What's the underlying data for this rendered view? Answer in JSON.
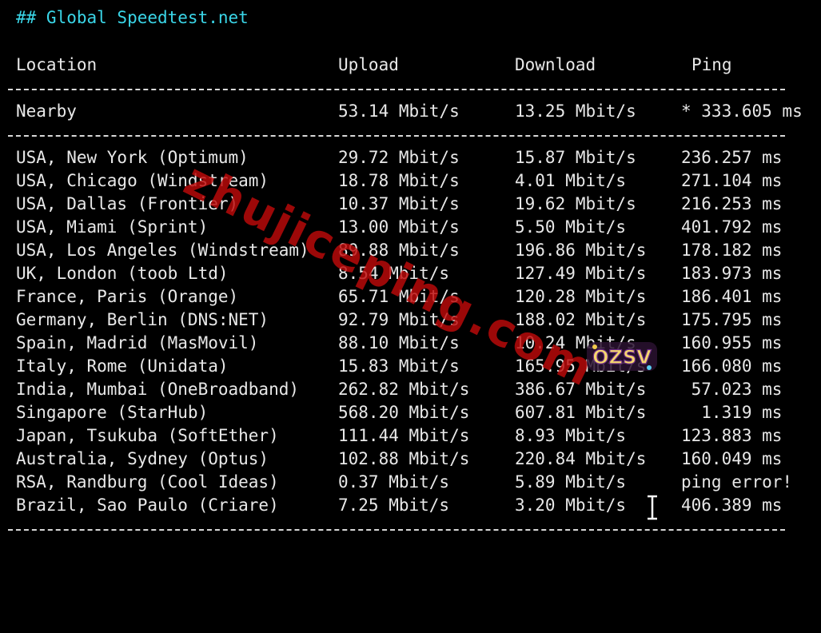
{
  "heading": "## Global Speedtest.net",
  "columns": {
    "location": "Location",
    "upload": "Upload",
    "download": "Download",
    "ping": "Ping"
  },
  "nearby": {
    "location": "Nearby",
    "upload": "53.14 Mbit/s",
    "download": "13.25 Mbit/s",
    "ping": "* 333.605 ms"
  },
  "rows": [
    {
      "location": "USA, New York (Optimum)",
      "upload": "29.72 Mbit/s",
      "download": "15.87 Mbit/s",
      "ping": "236.257 ms"
    },
    {
      "location": "USA, Chicago (Windstream)",
      "upload": "18.78 Mbit/s",
      "download": "4.01 Mbit/s",
      "ping": "271.104 ms"
    },
    {
      "location": "USA, Dallas (Frontier)",
      "upload": "10.37 Mbit/s",
      "download": "19.62 Mbit/s",
      "ping": "216.253 ms"
    },
    {
      "location": "USA, Miami (Sprint)",
      "upload": "13.00 Mbit/s",
      "download": "5.50 Mbit/s",
      "ping": "401.792 ms"
    },
    {
      "location": "USA, Los Angeles (Windstream)",
      "upload": "89.88 Mbit/s",
      "download": "196.86 Mbit/s",
      "ping": "178.182 ms"
    },
    {
      "location": "UK, London (toob Ltd)",
      "upload": "8.54 Mbit/s",
      "download": "127.49 Mbit/s",
      "ping": "183.973 ms"
    },
    {
      "location": "France, Paris (Orange)",
      "upload": "65.71 Mbit/s",
      "download": "120.28 Mbit/s",
      "ping": "186.401 ms"
    },
    {
      "location": "Germany, Berlin (DNS:NET)",
      "upload": "92.79 Mbit/s",
      "download": "188.02 Mbit/s",
      "ping": "175.795 ms"
    },
    {
      "location": "Spain, Madrid (MasMovil)",
      "upload": "88.10 Mbit/s",
      "download": "10.24 Mbit/s",
      "ping": "160.955 ms"
    },
    {
      "location": "Italy, Rome (Unidata)",
      "upload": "15.83 Mbit/s",
      "download": "165.95 Mbit/s",
      "ping": "166.080 ms"
    },
    {
      "location": "India, Mumbai (OneBroadband)",
      "upload": "262.82 Mbit/s",
      "download": "386.67 Mbit/s",
      "ping": " 57.023 ms"
    },
    {
      "location": "Singapore (StarHub)",
      "upload": "568.20 Mbit/s",
      "download": "607.81 Mbit/s",
      "ping": "  1.319 ms"
    },
    {
      "location": "Japan, Tsukuba (SoftEther)",
      "upload": "111.44 Mbit/s",
      "download": "8.93 Mbit/s",
      "ping": "123.883 ms"
    },
    {
      "location": "Australia, Sydney (Optus)",
      "upload": "102.88 Mbit/s",
      "download": "220.84 Mbit/s",
      "ping": "160.049 ms"
    },
    {
      "location": "RSA, Randburg (Cool Ideas)",
      "upload": "0.37 Mbit/s",
      "download": "5.89 Mbit/s",
      "ping": "ping error!"
    },
    {
      "location": "Brazil, Sao Paulo (Criare)",
      "upload": "7.25 Mbit/s",
      "download": "3.20 Mbit/s",
      "ping": "406.389 ms"
    }
  ],
  "watermark": "zhujiceping.com",
  "logo_text": "OZSV",
  "colors": {
    "background": "#000000",
    "text": "#e8e8e8",
    "heading": "#3ad6e8",
    "watermark": "#be0a0a"
  }
}
